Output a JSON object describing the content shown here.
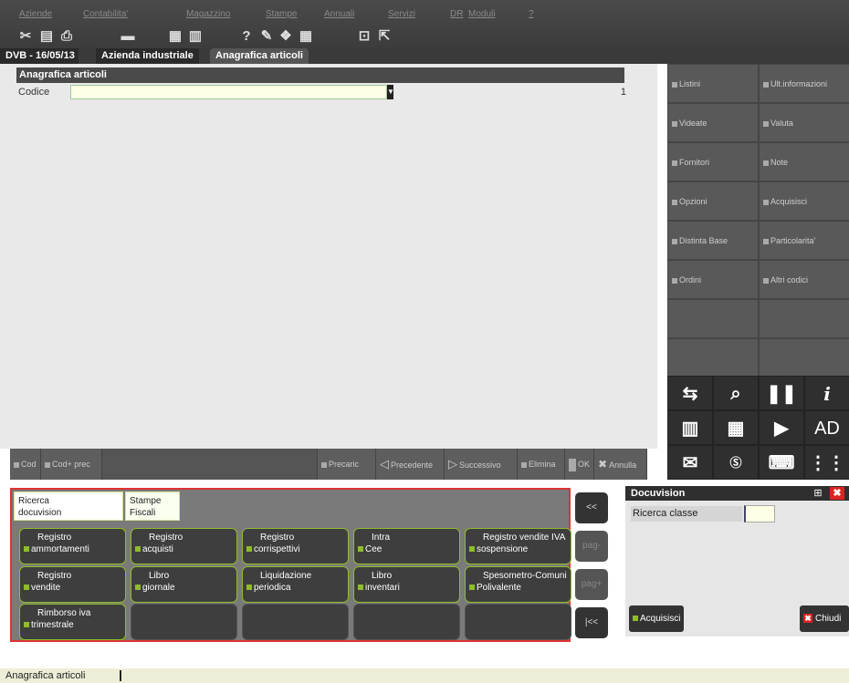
{
  "menu": [
    "Aziende",
    "Contabilita'",
    "Magazzino",
    "Stampe",
    "Annuali",
    "Servizi",
    "DR",
    "Moduli",
    "?"
  ],
  "toolbar_icons": [
    "scissors-icon",
    "document-icon",
    "printer-icon",
    "print-icon",
    "calculator-icon",
    "grid-icon",
    "help-icon",
    "pen-icon",
    "stamp-icon",
    "calendar-icon",
    "expand-icon",
    "exit-icon"
  ],
  "tabs": {
    "context": "DVB - 16/05/13",
    "company": "Azienda industriale",
    "active": "Anagrafica articoli"
  },
  "panel": {
    "title": "Anagrafica articoli",
    "codice_label": "Codice",
    "codice_value": "",
    "row_count": "1"
  },
  "right_buttons": [
    [
      "Listini",
      "Ult.informazioni"
    ],
    [
      "Videate",
      "Valuta"
    ],
    [
      "Fornitori",
      "Note"
    ],
    [
      "Opzioni",
      "Acquisisci"
    ],
    [
      "Distinta Base",
      "Particolarita'"
    ],
    [
      "Ordini",
      "Altri codici"
    ]
  ],
  "icon_buttons": [
    "pause-label",
    "AD"
  ],
  "button_bar": {
    "cod": "Cod",
    "cod_prec": "Cod+ prec",
    "precaric": "Precaric",
    "precedente": "Precedente",
    "successivo": "Successivo",
    "elimina": "Elimina",
    "ok": "OK",
    "annulla": "Annulla"
  },
  "bottom": {
    "tab1_l1": "Ricerca",
    "tab1_l2": "docuvision",
    "tab2_l1": "Stampe",
    "tab2_l2": "Fiscali",
    "grid": [
      [
        {
          "l1": "Registro",
          "l2": "ammortamenti"
        },
        {
          "l1": "Registro",
          "l2": "acquisti"
        },
        {
          "l1": "Registro",
          "l2": "corrispettivi"
        },
        {
          "l1": "Intra",
          "l2": "Cee"
        },
        {
          "l1": "Registro vendite IVA in",
          "l2": "sospensione"
        }
      ],
      [
        {
          "l1": "Registro",
          "l2": "vendite"
        },
        {
          "l1": "Libro",
          "l2": "giornale"
        },
        {
          "l1": "Liquidazione",
          "l2": "periodica"
        },
        {
          "l1": "Libro",
          "l2": "inventari"
        },
        {
          "l1": "Spesometro-Comunica",
          "l2": "Polivalente"
        }
      ],
      [
        {
          "l1": "Rimborso iva",
          "l2": "trimestrale"
        }
      ]
    ],
    "nav": {
      "first": "<<",
      "pgup": "pag-",
      "pgdn": "pag+",
      "last": "|<<"
    }
  },
  "docuvision": {
    "title": "Docuvision",
    "field_label": "Ricerca classe",
    "field_value": "",
    "acq_label": "Acquisisci",
    "close_label": "Chiudi"
  },
  "status": {
    "text": "Anagrafica articoli"
  },
  "colors": {
    "accent_green": "#8fbc2a",
    "dark": "#3d3d3d",
    "highlight_red": "#d33"
  }
}
